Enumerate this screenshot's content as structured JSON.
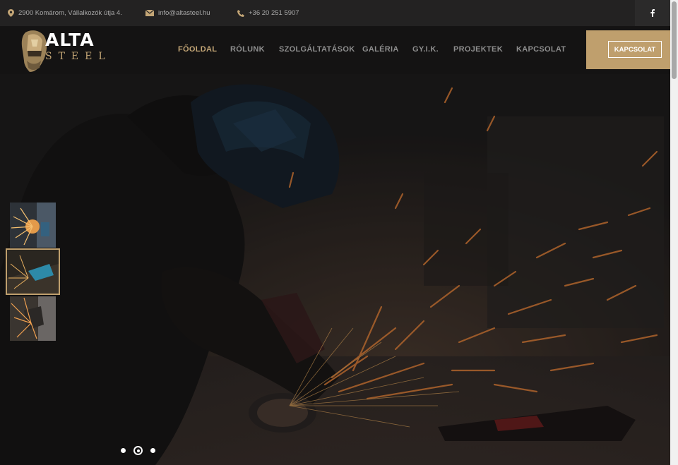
{
  "topbar": {
    "address": "2900 Komárom, Vállalkozók útja 4.",
    "email": "info@altasteel.hu",
    "phone": "+36 20 251 5907",
    "address_icon": "location-pin-icon",
    "email_icon": "envelope-icon",
    "phone_icon": "phone-icon",
    "social_icon": "facebook-icon"
  },
  "logo": {
    "line1": "ALTA",
    "line2": "STEEL"
  },
  "nav": {
    "items": [
      {
        "label": "FŐOLDAL",
        "active": true
      },
      {
        "label": "RÓLUNK",
        "active": false
      },
      {
        "label": "SZOLGÁLTATÁSOK",
        "active": false
      },
      {
        "label": "GALÉRIA",
        "active": false
      },
      {
        "label": "GY.I.K.",
        "active": false
      },
      {
        "label": "PROJEKTEK",
        "active": false
      },
      {
        "label": "KAPCSOLAT",
        "active": false
      }
    ],
    "cta_label": "KAPCSOLAT"
  },
  "slider": {
    "slide_count": 3,
    "active_slide": 2
  },
  "colors": {
    "accent": "#bf9f6d",
    "topbar_bg": "#232222",
    "header_bg": "#141313",
    "nav_text": "#8e8e8e",
    "spark": "#e8843a"
  }
}
